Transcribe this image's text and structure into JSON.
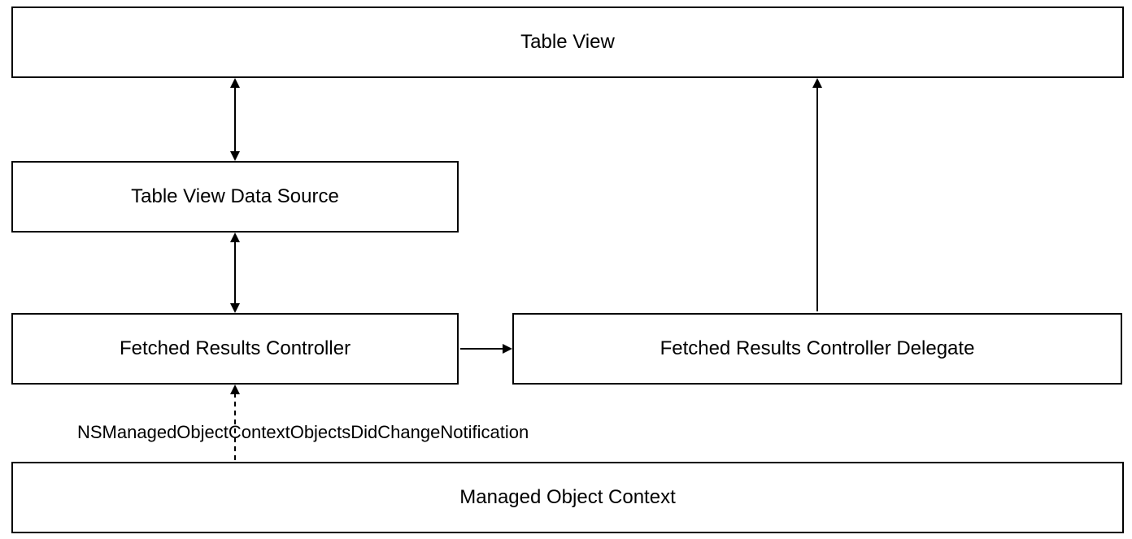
{
  "diagram": {
    "nodes": {
      "tableView": "Table View",
      "dataSource": "Table View Data Source",
      "frc": "Fetched Results Controller",
      "frcDelegate": "Fetched Results Controller Delegate",
      "moc": "Managed Object Context"
    },
    "edgeLabel": "NSManagedObjectContextObjectsDidChangeNotification",
    "edges": [
      {
        "from": "tableView",
        "to": "dataSource",
        "style": "solid",
        "bidirectional": true
      },
      {
        "from": "dataSource",
        "to": "frc",
        "style": "solid",
        "bidirectional": true
      },
      {
        "from": "frc",
        "to": "frcDelegate",
        "style": "solid",
        "bidirectional": false
      },
      {
        "from": "frcDelegate",
        "to": "tableView",
        "style": "solid",
        "bidirectional": false
      },
      {
        "from": "moc",
        "to": "frc",
        "style": "dashed",
        "bidirectional": false,
        "label": "NSManagedObjectContextObjectsDidChangeNotification"
      }
    ],
    "colors": {
      "line": "#000000",
      "background": "#ffffff"
    }
  }
}
